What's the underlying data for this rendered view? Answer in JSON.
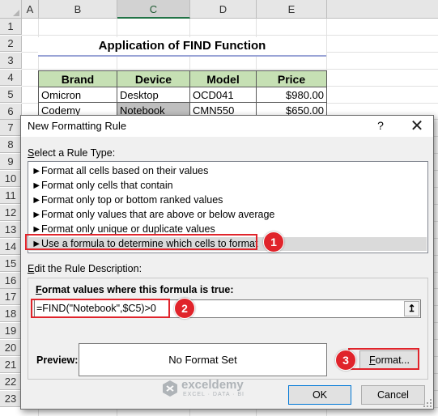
{
  "spreadsheet": {
    "columns": [
      "A",
      "B",
      "C",
      "D",
      "E"
    ],
    "selected_column": "C",
    "rows": [
      "1",
      "2",
      "3",
      "4",
      "5",
      "6",
      "7",
      "8",
      "9",
      "10",
      "11",
      "12",
      "13",
      "14",
      "15",
      "16",
      "17",
      "18",
      "19",
      "20",
      "21",
      "22",
      "23"
    ],
    "title": "Application of FIND Function",
    "table_headers": [
      "Brand",
      "Device",
      "Model",
      "Price"
    ],
    "table_rows": [
      [
        "Omicron",
        "Desktop",
        "OCD041",
        "$980.00"
      ],
      [
        "Codemy",
        "Notebook",
        "CMN550",
        "$650.00"
      ]
    ],
    "header_color": "#c6e0b4",
    "highlight_color": "#bfbfbf"
  },
  "dialog": {
    "title": "New Formatting Rule",
    "help_label": "?",
    "close_label": "✕",
    "select_rule_type_label": "elect a Rule Type:",
    "select_rule_type_accel": "S",
    "rule_types": [
      "Format all cells based on their values",
      "Format only cells that contain",
      "Format only top or bottom ranked values",
      "Format only values that are above or below average",
      "Format only unique or duplicate values",
      "Use a formula to determine which cells to format"
    ],
    "selected_rule_index": 5,
    "rule_arrow": "►",
    "edit_description_label": "dit the Rule Description:",
    "edit_description_accel": "E",
    "formula_label_accel": "F",
    "formula_label": "ormat values where this formula is true:",
    "formula_value": "=FIND(\"Notebook\",$C5)>0",
    "collapse_icon": "↥",
    "preview_label": "Preview:",
    "preview_text": "No Format Set",
    "format_button_accel": "F",
    "format_button_label": "ormat...",
    "ok_label": "OK",
    "cancel_label": "Cancel"
  },
  "annotations": {
    "badge_1": "1",
    "badge_2": "2",
    "badge_3": "3",
    "accent_color": "#e0242b"
  },
  "watermark": {
    "name": "exceldemy",
    "tagline": "EXCEL · DATA · BI"
  }
}
